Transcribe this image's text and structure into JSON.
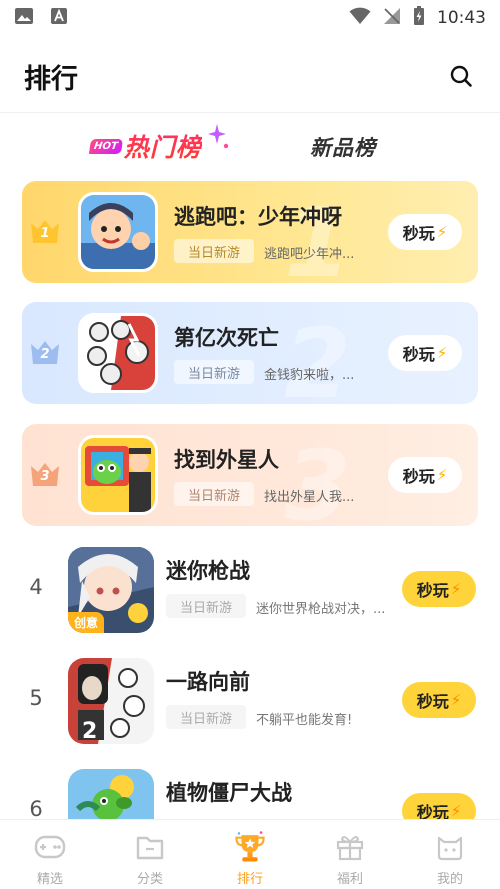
{
  "status_bar": {
    "time": "10:43"
  },
  "header": {
    "title": "排行"
  },
  "tabs": {
    "hot_badge": "HOT",
    "hot": "热门榜",
    "new": "新品榜"
  },
  "play_label": "秒玩",
  "top_ranks": [
    {
      "rank": "1",
      "name": "逃跑吧：少年冲呀",
      "tag": "当日新游",
      "desc": "逃跑吧少年冲..."
    },
    {
      "rank": "2",
      "name": "第亿次死亡",
      "tag": "当日新游",
      "desc": "金钱豹来啦，..."
    },
    {
      "rank": "3",
      "name": "找到外星人",
      "tag": "当日新游",
      "desc": "找出外星人我..."
    }
  ],
  "list": [
    {
      "rank": "4",
      "name": "迷你枪战",
      "tag": "当日新游",
      "desc": "迷你世界枪战对决，...",
      "badge": "创意"
    },
    {
      "rank": "5",
      "name": "一路向前",
      "tag": "当日新游",
      "desc": "不躺平也能发育!"
    },
    {
      "rank": "6",
      "name": "植物僵尸大战",
      "tag": "",
      "desc": ""
    }
  ],
  "bottom_nav": [
    {
      "label": "精选"
    },
    {
      "label": "分类"
    },
    {
      "label": "排行"
    },
    {
      "label": "福利"
    },
    {
      "label": "我的"
    }
  ],
  "colors": {
    "accent": "#ff9f1a",
    "play_button": "#ffd43b",
    "hot_gradient_start": "#ff2f6b",
    "gold_card": "#ffe07a",
    "silver_card": "#dde9ff",
    "bronze_card": "#ffe4d5"
  }
}
